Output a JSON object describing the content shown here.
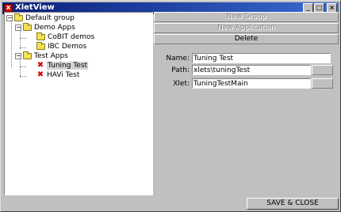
{
  "window": {
    "title": "XletView",
    "icon": "app-x-icon",
    "controls": [
      "minimize",
      "maximize",
      "close"
    ],
    "minimize_glyph": "_",
    "maximize_glyph": "□",
    "close_glyph": "×"
  },
  "tree": {
    "expander_glyph": "−",
    "nodes": [
      {
        "label": "Default group",
        "icon": "folder-open-icon"
      },
      {
        "label": "Demo Apps",
        "icon": "folder-open-icon"
      },
      {
        "label": "CoBIT demos",
        "icon": "folder-icon"
      },
      {
        "label": "IBC Demos",
        "icon": "folder-icon"
      },
      {
        "label": "Test Apps",
        "icon": "folder-open-icon"
      },
      {
        "label": "Tuning Test",
        "icon": "xlet-x-icon",
        "selected": true
      },
      {
        "label": "HAVi Test",
        "icon": "xlet-x-icon"
      }
    ]
  },
  "actions": {
    "new_group": "New Group",
    "new_application": "New Application",
    "delete": "Delete"
  },
  "form": {
    "name_label": "Name:",
    "name_value": "Tuning Test",
    "path_label": "Path:",
    "path_value": "xlets\\tuningTest",
    "xlet_label": "Xlet:",
    "xlet_value": "TuningTestMain"
  },
  "footer": {
    "save_close": "SAVE & CLOSE"
  },
  "colors": {
    "titlebar_start": "#0a1f7a",
    "titlebar_end": "#3a6bd0",
    "window_bg": "#c0c0c0",
    "xlet_icon": "#d00000",
    "folder": "#f2e05a"
  }
}
